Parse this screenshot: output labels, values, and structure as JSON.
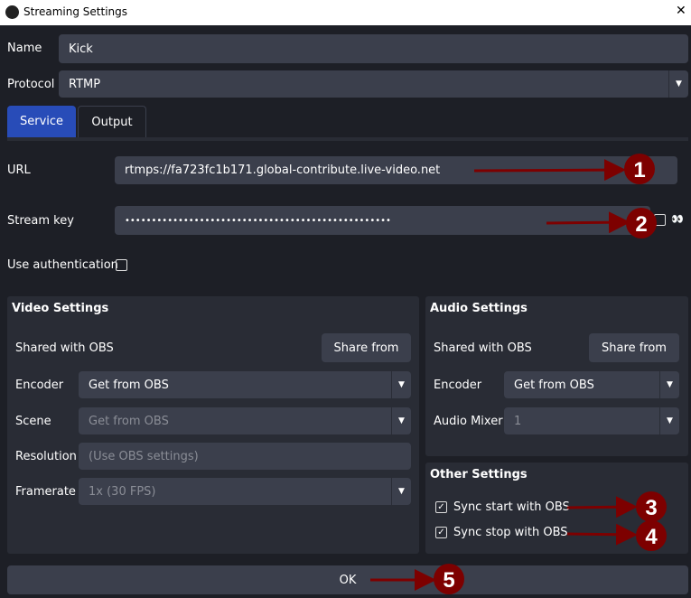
{
  "window": {
    "title": "Streaming Settings",
    "close": "✕"
  },
  "name": {
    "label": "Name",
    "value": "Kick"
  },
  "protocol": {
    "label": "Protocol",
    "value": "RTMP"
  },
  "tabs": [
    {
      "label": "Service",
      "active": true
    },
    {
      "label": "Output",
      "active": false
    }
  ],
  "url": {
    "label": "URL",
    "value": "rtmps://fa723fc1b171.global-contribute.live-video.net"
  },
  "stream_key": {
    "label": "Stream key",
    "value": "••••••••••••••••••••••••••••••••••••••••••••••••••",
    "show_icon": "👀"
  },
  "use_auth": {
    "label": "Use authentication",
    "checked": false
  },
  "video": {
    "title": "Video Settings",
    "shared_label": "Shared with OBS",
    "share_button": "Share from",
    "encoder_label": "Encoder",
    "encoder_value": "Get from OBS",
    "scene_label": "Scene",
    "scene_value": "Get from OBS",
    "resolution_label": "Resolution",
    "resolution_placeholder": "(Use OBS settings)",
    "framerate_label": "Framerate",
    "framerate_value": "1x (30 FPS)"
  },
  "audio": {
    "title": "Audio Settings",
    "shared_label": "Shared with OBS",
    "share_button": "Share from",
    "encoder_label": "Encoder",
    "encoder_value": "Get from OBS",
    "mixer_label": "Audio Mixer",
    "mixer_value": "1"
  },
  "other": {
    "title": "Other Settings",
    "sync_start": "Sync start with OBS",
    "sync_stop": "Sync stop with OBS",
    "check": "✓"
  },
  "ok_button": "OK",
  "annotations": [
    "1",
    "2",
    "3",
    "4",
    "5"
  ],
  "colors": {
    "accent": "#284cb8",
    "annotation": "#7d0000"
  }
}
